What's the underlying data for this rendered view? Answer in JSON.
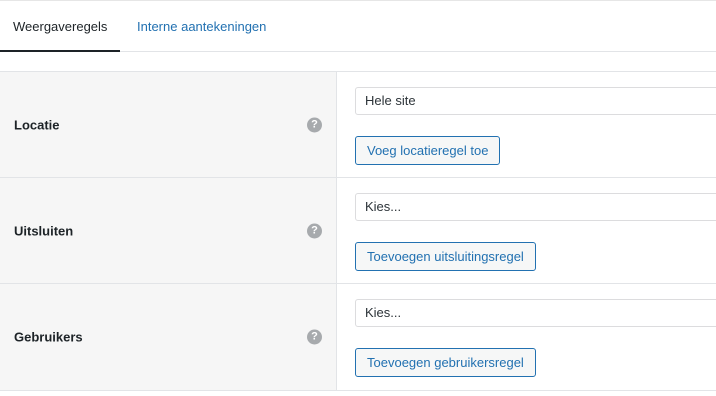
{
  "tabs": [
    {
      "label": "Weergaveregels",
      "active": true
    },
    {
      "label": "Interne aantekeningen",
      "active": false
    }
  ],
  "rules": [
    {
      "label": "Locatie",
      "help": "?",
      "select_value": "Hele site",
      "button_label": "Voeg locatieregel toe"
    },
    {
      "label": "Uitsluiten",
      "help": "?",
      "select_value": "Kies...",
      "button_label": "Toevoegen uitsluitingsregel"
    },
    {
      "label": "Gebruikers",
      "help": "?",
      "select_value": "Kies...",
      "button_label": "Toevoegen gebruikersregel"
    }
  ],
  "colors": {
    "accent": "#2271b1",
    "label_bg": "#f6f6f6",
    "help_icon": "#a7aaad"
  }
}
